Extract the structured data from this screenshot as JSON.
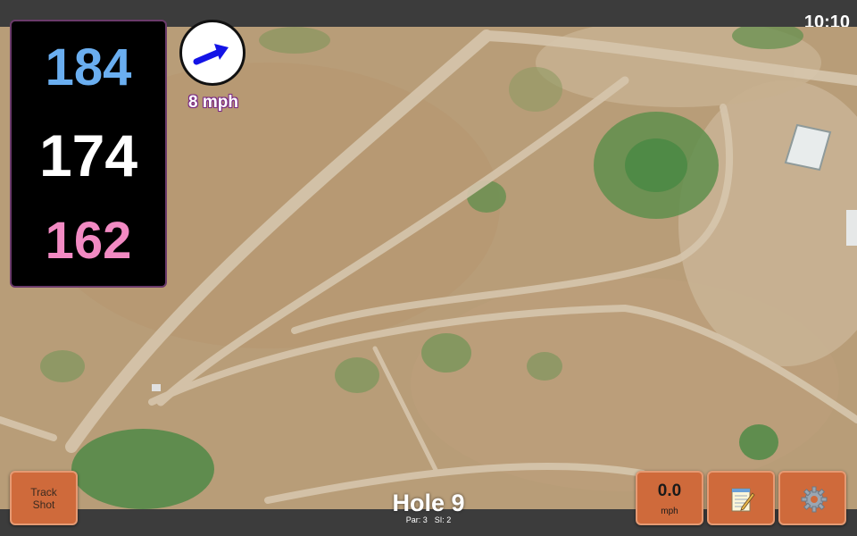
{
  "status_bar": {
    "time": "10:10"
  },
  "distances": {
    "back": "184",
    "middle": "174",
    "front": "162"
  },
  "wind": {
    "speed_label": "8 mph",
    "direction_icon": "wind-arrow-icon"
  },
  "buttons": {
    "track_shot_label": "Track Shot",
    "speed_value": "0.0",
    "speed_unit": "mph",
    "notes_icon": "notepad-icon",
    "settings_icon": "gear-icon"
  },
  "hole": {
    "title": "Hole 9",
    "par": "Par: 3",
    "si": "SI: 2"
  },
  "colors": {
    "back_distance": "#6aaef0",
    "middle_distance": "#ffffff",
    "front_distance": "#f28ac3",
    "button": "#cf6a3b",
    "wind_arrow": "#1414e6"
  }
}
